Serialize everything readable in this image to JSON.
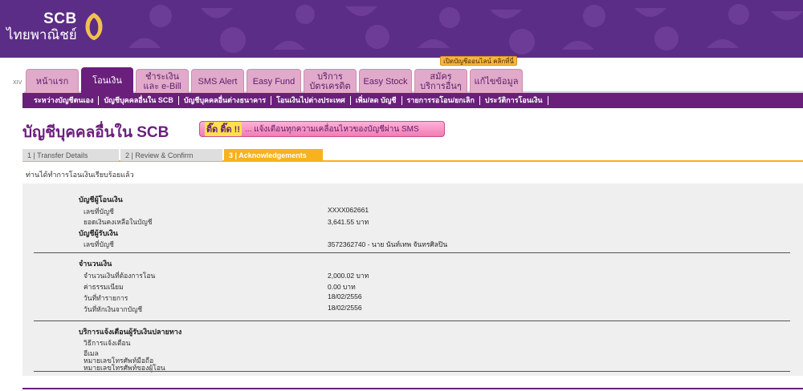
{
  "header": {
    "logo_line1": "SCB",
    "logo_line2": "ไทยพาณิชย์",
    "brand_color": "#5c2d86"
  },
  "xiv_label": "XIV",
  "tabs": [
    {
      "label": "หน้าแรก"
    },
    {
      "label": "โอนเงิน",
      "active": true
    },
    {
      "label": "ชำระเงิน และ e-Bill"
    },
    {
      "label": "SMS Alert"
    },
    {
      "label": "Easy Fund"
    },
    {
      "label": "บริการ บัตรเครดิต"
    },
    {
      "label": "Easy Stock"
    },
    {
      "label": "สมัคร บริการอื่นๆ"
    },
    {
      "label": "แก้ไขข้อมูล"
    }
  ],
  "promo_badge": "เปิดบัญชีออนไลน์ คลิกที่นี่",
  "subnav": [
    "ระหว่างบัญชีตนเอง",
    "บัญชีบุคคลอื่นใน SCB",
    "บัญชีบุคคลอื่นต่างธนาคาร",
    "โอนเงินไปต่างประเทศ",
    "เพิ่ม/ลด บัญชี",
    "รายการรอโอน/ยกเลิก",
    "ประวัติการโอนเงิน"
  ],
  "page_title": "บัญชีบุคคลอื่นใน SCB",
  "sms_banner": {
    "highlight": "ติ๊ด ติ๊ด !!",
    "text": "... แจ้งเตือนทุกความเคลื่อนไหวของบัญชีผ่าน SMS"
  },
  "steps": [
    "1 | Transfer Details",
    "2 | Review & Confirm",
    "3 | Acknowledgements"
  ],
  "done_message": "ท่านได้ทำการโอนเงินเรียบร้อยแล้ว",
  "from_account": {
    "heading": "บัญชีผู้โอนเงิน",
    "account_no_label": "เลขที่บัญชี",
    "account_no": "XXXX062661",
    "balance_label": "ยอดเงินคงเหลือในบัญชี",
    "balance": "3,641.55 บาท"
  },
  "to_account": {
    "heading": "บัญชีผู้รับเงิน",
    "account_no_label": "เลขที่บัญชี",
    "account_no": "3572362740 - นาย นันท์เทพ จันทรศิลปิน"
  },
  "amount": {
    "heading": "จำนวนเงิน",
    "transfer_label": "จำนวนเงินที่ต้องการโอน",
    "transfer_value": "2,000.02 บาท",
    "fee_label": "ค่าธรรมเนียม",
    "fee_value": "0.00  บาท",
    "txn_date_label": "วันที่ทำรายการ",
    "txn_date": "18/02/2556",
    "debit_date_label": "วันที่หักเงินจากบัญชี",
    "debit_date": "18/02/2556"
  },
  "notify": {
    "heading": "บริการแจ้งเตือนผู้รับเงินปลายทาง",
    "method_label": "วิธีการแจ้งเตือน",
    "email_label": "อีเมล",
    "mobile_label": "หมายเลขโทรศัพท์มือถือ",
    "sender_phone_label": "หมายเลขโทรศัพท์ของผู้โอน"
  }
}
